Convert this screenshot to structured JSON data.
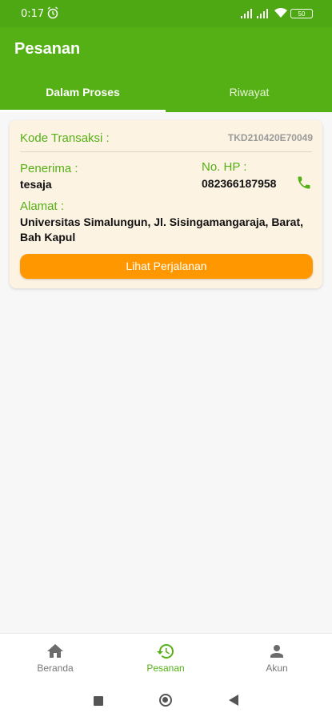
{
  "status_bar": {
    "time": "0:17",
    "battery": "50"
  },
  "app_bar": {
    "title": "Pesanan"
  },
  "tabs": [
    {
      "label": "Dalam Proses",
      "active": true
    },
    {
      "label": "Riwayat",
      "active": false
    }
  ],
  "order": {
    "kode_label": "Kode Transaksi :",
    "kode_value": "TKD210420E70049",
    "penerima_label": "Penerima :",
    "penerima_value": "tesaja",
    "hp_label": "No. HP :",
    "hp_value": "082366187958",
    "alamat_label": "Alamat :",
    "alamat_value": "Universitas Simalungun, Jl. Sisingamangaraja, Barat, Bah Kapul",
    "button_label": "Lihat Perjalanan"
  },
  "bottom_nav": [
    {
      "label": "Beranda",
      "icon": "home-icon",
      "active": false
    },
    {
      "label": "Pesanan",
      "icon": "history-icon",
      "active": true
    },
    {
      "label": "Akun",
      "icon": "person-icon",
      "active": false
    }
  ],
  "colors": {
    "primary": "#55b015",
    "accent": "#ff9800",
    "card_bg": "#fdf3e3"
  }
}
